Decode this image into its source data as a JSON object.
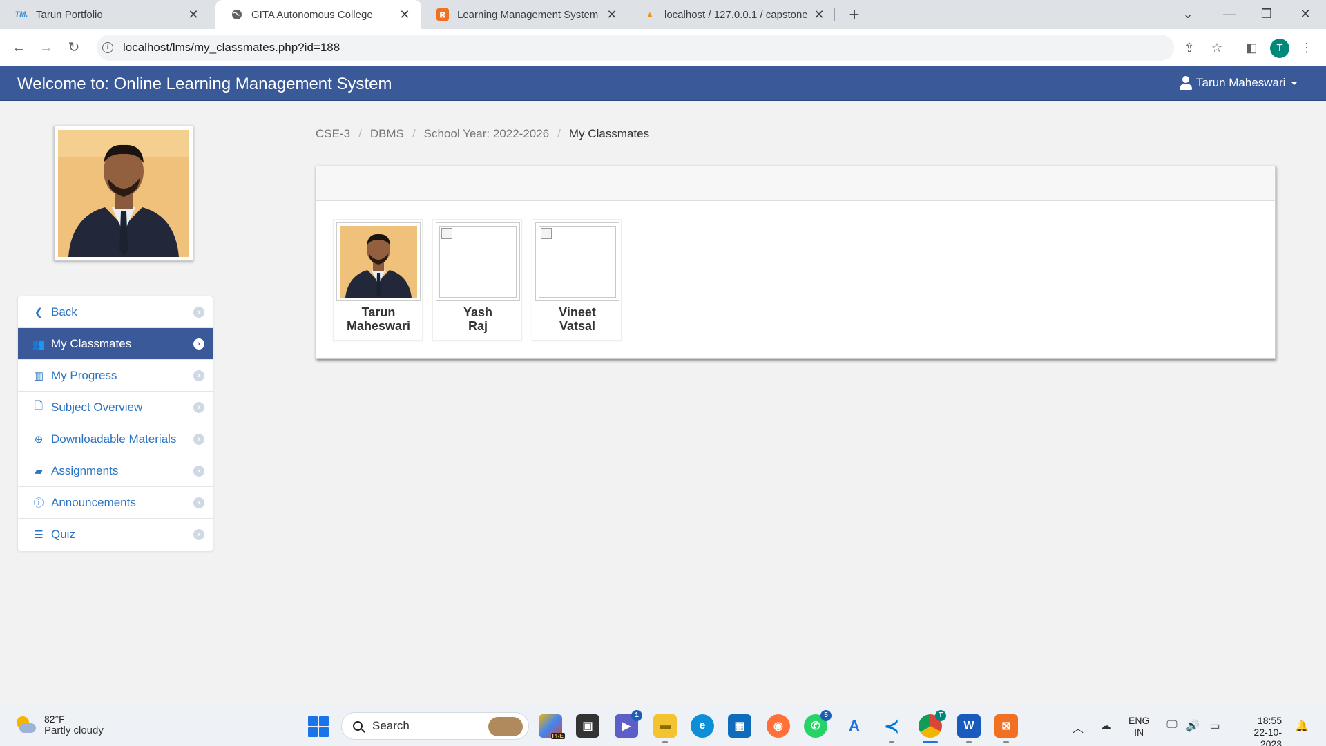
{
  "browser": {
    "tabs": [
      {
        "title": "Tarun Portfolio",
        "favicon": "TM."
      },
      {
        "title": "GITA Autonomous College",
        "favicon": "globe-icon"
      },
      {
        "title": "Learning Management System",
        "favicon": "xampp-icon"
      },
      {
        "title": "localhost / 127.0.0.1 / capstone",
        "favicon": "phpmyadmin-icon"
      }
    ],
    "url": "localhost/lms/my_classmates.php?id=188",
    "profile_initial": "T"
  },
  "app": {
    "brand": "Welcome to: Online Learning Management System",
    "user_name": "Tarun Maheswari",
    "accent_color": "#3a5998"
  },
  "breadcrumb": {
    "items": [
      "CSE-3",
      "DBMS",
      "School Year: 2022-2026"
    ],
    "current": "My Classmates"
  },
  "sidebar": {
    "items": [
      {
        "label": "Back",
        "icon": "chevron-left-icon"
      },
      {
        "label": "My Classmates",
        "icon": "users-icon",
        "active": true
      },
      {
        "label": "My Progress",
        "icon": "bar-chart-icon"
      },
      {
        "label": "Subject Overview",
        "icon": "file-icon"
      },
      {
        "label": "Downloadable Materials",
        "icon": "download-icon"
      },
      {
        "label": "Assignments",
        "icon": "book-icon"
      },
      {
        "label": "Announcements",
        "icon": "info-icon"
      },
      {
        "label": "Quiz",
        "icon": "list-icon"
      }
    ]
  },
  "classmates": [
    {
      "first": "Tarun",
      "last": "Maheswari",
      "has_photo": true
    },
    {
      "first": "Yash",
      "last": "Raj",
      "has_photo": false
    },
    {
      "first": "Vineet",
      "last": "Vatsal",
      "has_photo": false
    }
  ],
  "taskbar": {
    "weather_temp": "82°F",
    "weather_desc": "Partly cloudy",
    "search_label": "Search",
    "lang_top": "ENG",
    "lang_bottom": "IN",
    "time": "18:55",
    "date": "22-10-2023",
    "teams_badge": "1",
    "whatsapp_badge": "5",
    "chrome_badge": "T",
    "copilot_label": "PRE"
  }
}
